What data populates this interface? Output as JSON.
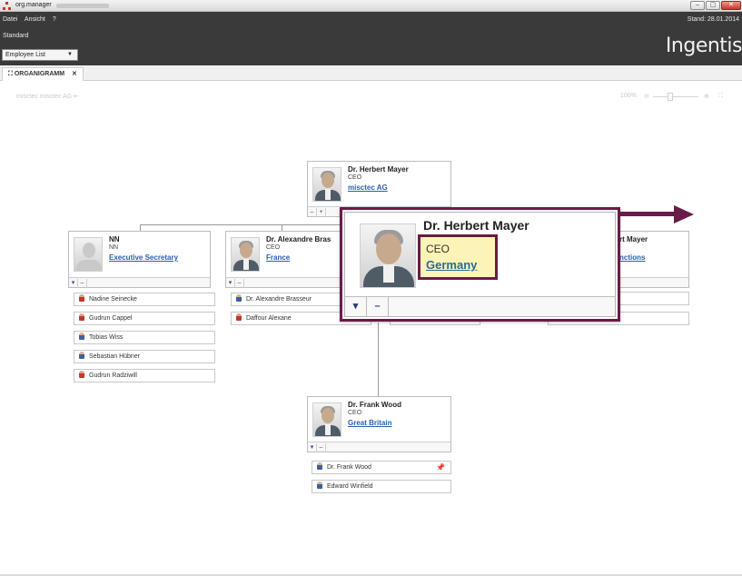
{
  "window": {
    "title": "org.manager",
    "controls": [
      "–",
      "▢",
      "✕"
    ]
  },
  "menu": {
    "items": [
      "Datei",
      "Ansicht",
      "?"
    ],
    "stand": "Stand: 28.01.2014",
    "standard_label": "Standard",
    "dropdown_value": "Employee List"
  },
  "brand": {
    "logo": "Ingentis"
  },
  "tab": {
    "label": "ORGANIGRAMM",
    "close": "✕"
  },
  "breadcrumb": "misctec  misctec AG  ⇤",
  "zoom": {
    "value": "100%",
    "minus": "⊖",
    "plus": "⊕",
    "fit": "⛶"
  },
  "cards": {
    "top": {
      "name": "Dr. Herbert Mayer",
      "role": "CEO",
      "unit": "misctec AG"
    },
    "left": {
      "name": "NN",
      "role": "NN",
      "unit": "Executive Secretary"
    },
    "mid": {
      "name": "Dr. Alexandre Bras",
      "role": "CEO",
      "unit": "France"
    },
    "right": {
      "name": "rt Mayer",
      "unit": "nctions"
    },
    "bottom": {
      "name": "Dr. Frank Wood",
      "role": "CEO",
      "unit": "Great Britain"
    }
  },
  "controls": {
    "collapse": "▾",
    "minus": "–",
    "plus": "+"
  },
  "members": {
    "left": [
      {
        "name": "Nadine Seinecke",
        "gender": "f"
      },
      {
        "name": "Gudrun Cappel",
        "gender": "f"
      },
      {
        "name": "Tobias Wiss",
        "gender": "m"
      },
      {
        "name": "Sebastian Hübner",
        "gender": "m"
      },
      {
        "name": "Gudrun Radziwill",
        "gender": "f"
      }
    ],
    "mid": [
      {
        "name": "Dr. Alexandre Brasseur",
        "gender": "m"
      },
      {
        "name": "Daffour Alexane",
        "gender": "f"
      }
    ],
    "bottom": [
      {
        "name": "Dr. Frank Wood",
        "gender": "m"
      },
      {
        "name": "Edward Winfield",
        "gender": "m"
      }
    ],
    "pin_icon": "📌"
  },
  "callout": {
    "name": "Dr. Herbert Mayer",
    "role": "CEO",
    "unit": "Germany"
  },
  "colors": {
    "accent": "#6a1b47",
    "link": "#2a5db0",
    "chrome": "#3a3a3a"
  }
}
